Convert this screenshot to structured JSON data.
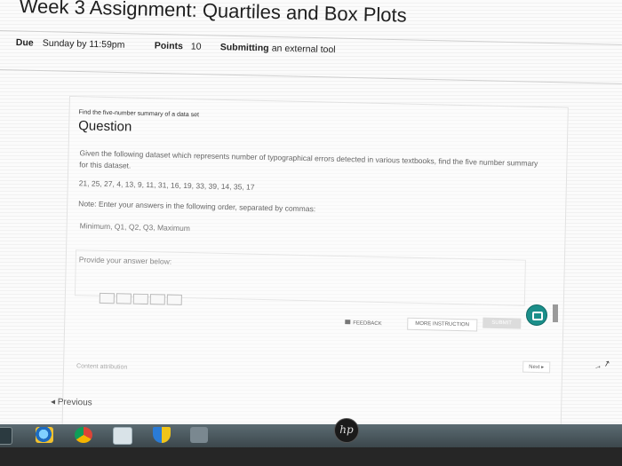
{
  "header": {
    "title": "Week 3 Assignment: Quartiles and Box Plots",
    "due_label": "Due",
    "due_value": "Sunday by 11:59pm",
    "points_label": "Points",
    "points_value": "10",
    "submitting_label": "Submitting",
    "submitting_value": "an external tool"
  },
  "question": {
    "subtitle": "Find the five-number summary of a data set",
    "title": "Question",
    "body": "Given the following dataset which represents number of typographical errors detected in various textbooks, find the five number summary for this dataset.",
    "dataset": "21, 25, 27, 4, 13, 9, 11, 31, 16, 19, 33, 39, 14, 35, 17",
    "note": "Note: Enter your answers in the following order, separated by commas:",
    "order": "Minimum, Q1, Q2, Q3, Maximum",
    "answer_label": "Provide your answer below:",
    "blank_count": 5
  },
  "buttons": {
    "feedback": "FEEDBACK",
    "more_instruction": "MORE INSTRUCTION",
    "submit": "SUBMIT",
    "next": "Next"
  },
  "footer": {
    "attribution": "Content attribution",
    "previous": "Previous"
  },
  "colors": {
    "toggle": "#1b8f8a"
  }
}
